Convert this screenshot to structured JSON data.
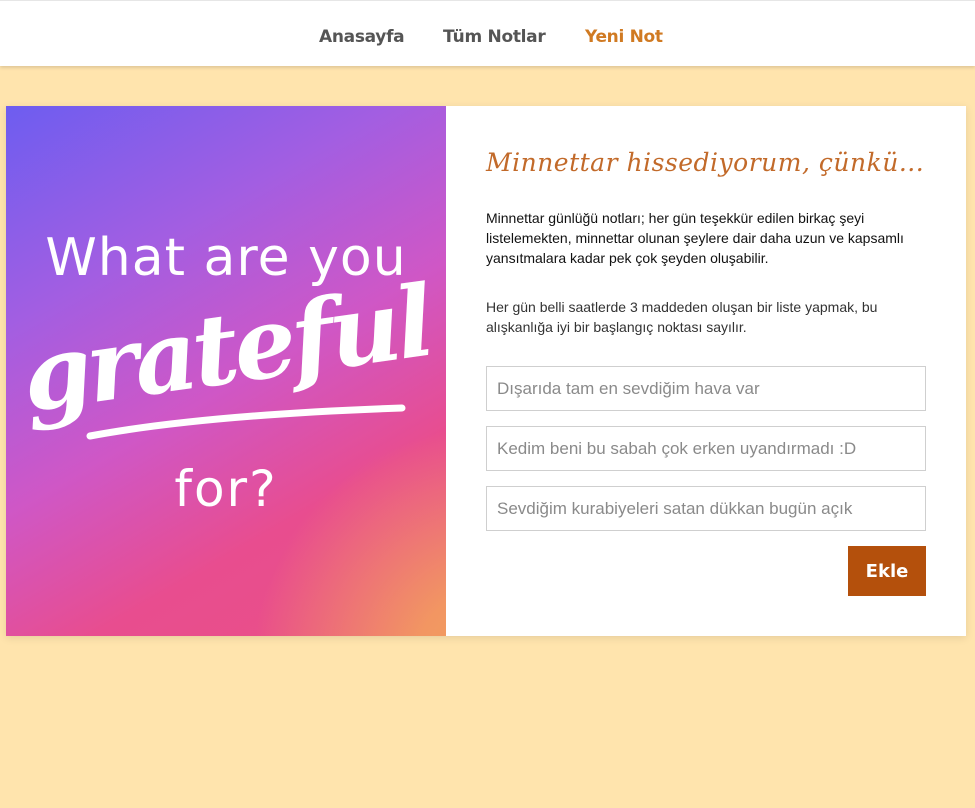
{
  "nav": {
    "items": [
      {
        "label": "Anasayfa"
      },
      {
        "label": "Tüm Notlar"
      },
      {
        "label": "Yeni Not"
      }
    ],
    "active_index": 2,
    "active_color": "#d07a22"
  },
  "hero": {
    "line1": "What are you",
    "line2": "grateful",
    "line3": "for?"
  },
  "form": {
    "title": "Minnettar hissediyorum, çünkü...",
    "paragraph1": "Minnettar günlüğü notları; her gün teşekkür edilen birkaç şeyi listelemekten, minnettar olunan şeylere dair daha uzun ve kapsamlı yansıtmalara kadar pek çok şeyden oluşabilir.",
    "paragraph2": "Her gün belli saatlerde 3 maddeden oluşan bir liste yapmak, bu alışkanlığa iyi bir başlangıç noktası sayılır.",
    "inputs": [
      {
        "placeholder": "Dışarıda tam en sevdiğim hava var",
        "value": ""
      },
      {
        "placeholder": "Kedim beni bu sabah çok erken uyandırmadı :D",
        "value": ""
      },
      {
        "placeholder": "Sevdiğim kurabiyeleri satan dükkan bugün açık",
        "value": ""
      }
    ],
    "submit_label": "Ekle",
    "button_color": "#b4500c"
  },
  "colors": {
    "page_background": "#ffe4ad",
    "title_color": "#c26a2a"
  }
}
